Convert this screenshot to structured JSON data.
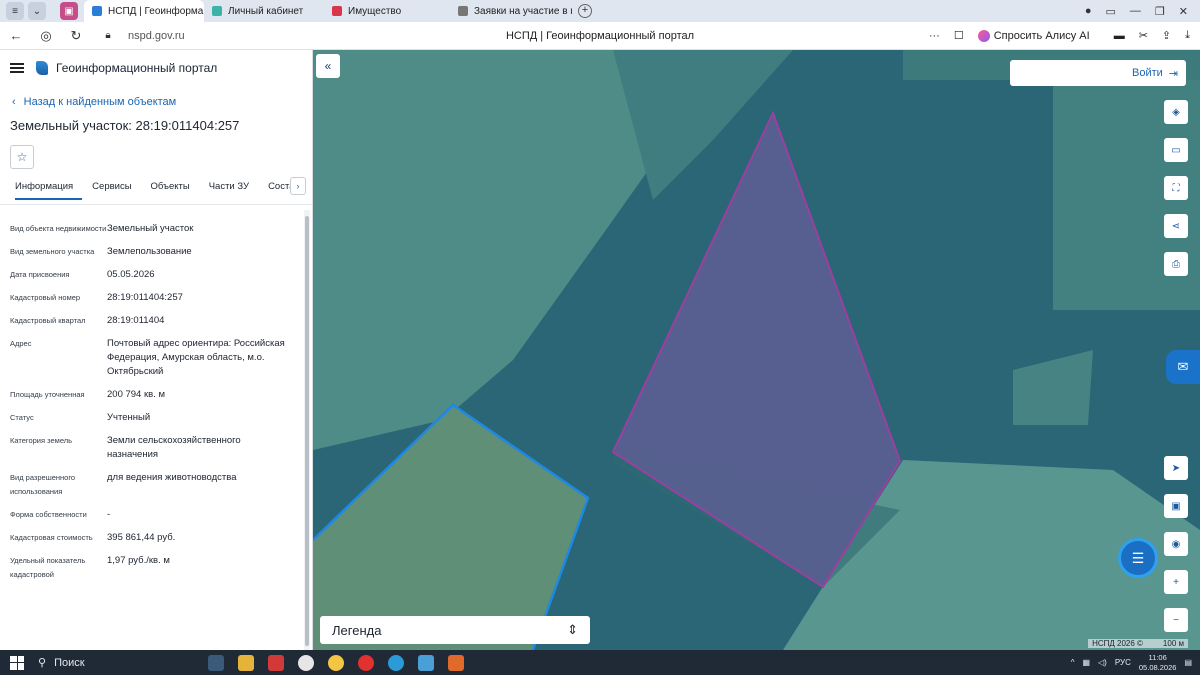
{
  "browser": {
    "tabs": [
      {
        "label": "НСПД | Геоинформаци",
        "active": true,
        "color": "#2a7fd4"
      },
      {
        "label": "Личный кабинет",
        "active": false,
        "color": "#3bb3a6"
      },
      {
        "label": "Имущество",
        "active": false,
        "color": "#d9354b"
      },
      {
        "label": "Заявки на участие в про",
        "active": false,
        "color": "#666666"
      }
    ],
    "url": "nspd.gov.ru",
    "page_title": "НСПД | Геоинформационный портал",
    "alice_label": "Спросить Алису AI"
  },
  "panel": {
    "app_name": "Геоинформационный портал",
    "back_label": "Назад к найденным объектам",
    "title": "Земельный участок: 28:19:011404:257",
    "tabs": [
      "Информация",
      "Сервисы",
      "Объекты",
      "Части ЗУ",
      "Состав"
    ],
    "properties": [
      {
        "label": "Вид объекта недвижимости",
        "value": "Земельный участок"
      },
      {
        "label": "Вид земельного участка",
        "value": "Землепользование"
      },
      {
        "label": "Дата присвоения",
        "value": "05.05.2026"
      },
      {
        "label": "Кадастровый номер",
        "value": "28:19:011404:257"
      },
      {
        "label": "Кадастровый квартал",
        "value": "28:19:011404"
      },
      {
        "label": "Адрес",
        "value": "Почтовый адрес ориентира: Российская Федерация, Амурская область, м.о. Октябрьский"
      },
      {
        "label": "Площадь уточненная",
        "value": "200 794 кв. м"
      },
      {
        "label": "Статус",
        "value": "Учтенный"
      },
      {
        "label": "Категория земель",
        "value": "Земли сельскохозяйственного назначения"
      },
      {
        "label": "Вид разрешенного использования",
        "value": "для ведения животноводства"
      },
      {
        "label": "Форма собственности",
        "value": "-"
      },
      {
        "label": "Кадастровая стоимость",
        "value": "395 861,44 руб."
      },
      {
        "label": "Удельный показатель кадастровой",
        "value": "1,97 руб./кв. м"
      }
    ]
  },
  "map": {
    "login_label": "Войти",
    "legend_label": "Легенда",
    "attribution": "НСПД 2026 ©",
    "scale": "100 м",
    "parcel_color": "#9b3fa0",
    "boundary_color": "#1e88e5"
  },
  "taskbar": {
    "search_label": "Поиск",
    "lang": "РУС",
    "time": "11:06",
    "date": "05.08.2026"
  }
}
